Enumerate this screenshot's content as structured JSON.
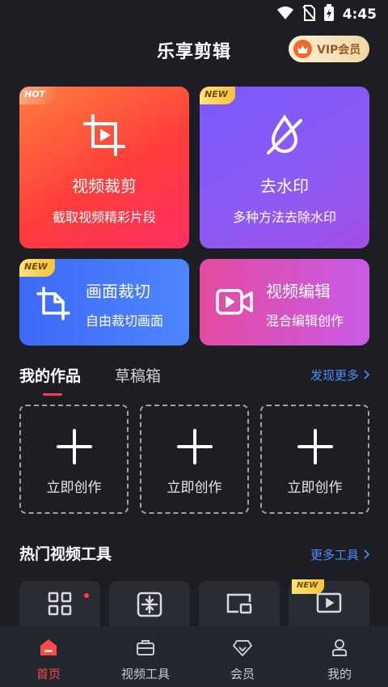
{
  "status_bar": {
    "time": "4:45"
  },
  "header": {
    "title": "乐享剪辑",
    "vip_label": "VIP会员"
  },
  "feature_cards": {
    "video_crop": {
      "badge": "HOT",
      "title": "视频裁剪",
      "subtitle": "截取视频精彩片段"
    },
    "remove_watermark": {
      "badge": "NEW",
      "title": "去水印",
      "subtitle": "多种方法去除水印"
    },
    "frame_crop": {
      "badge": "NEW",
      "title": "画面裁切",
      "subtitle": "自由裁切画面"
    },
    "video_edit": {
      "title": "视频编辑",
      "subtitle": "混合编辑创作"
    }
  },
  "works": {
    "tabs": [
      "我的作品",
      "草稿箱"
    ],
    "more_label": "发现更多",
    "create_label": "立即创作"
  },
  "tools": {
    "title": "热门视频工具",
    "more_label": "更多工具",
    "new_badge": "NEW"
  },
  "bottom_nav": {
    "items": [
      {
        "label": "首页",
        "active": true
      },
      {
        "label": "视频工具",
        "active": false
      },
      {
        "label": "会员",
        "active": false
      },
      {
        "label": "我的",
        "active": false
      }
    ]
  },
  "colors": {
    "accent_red": "#ff4a4a",
    "link_blue": "#4f8bff",
    "background": "#1c1e24"
  }
}
